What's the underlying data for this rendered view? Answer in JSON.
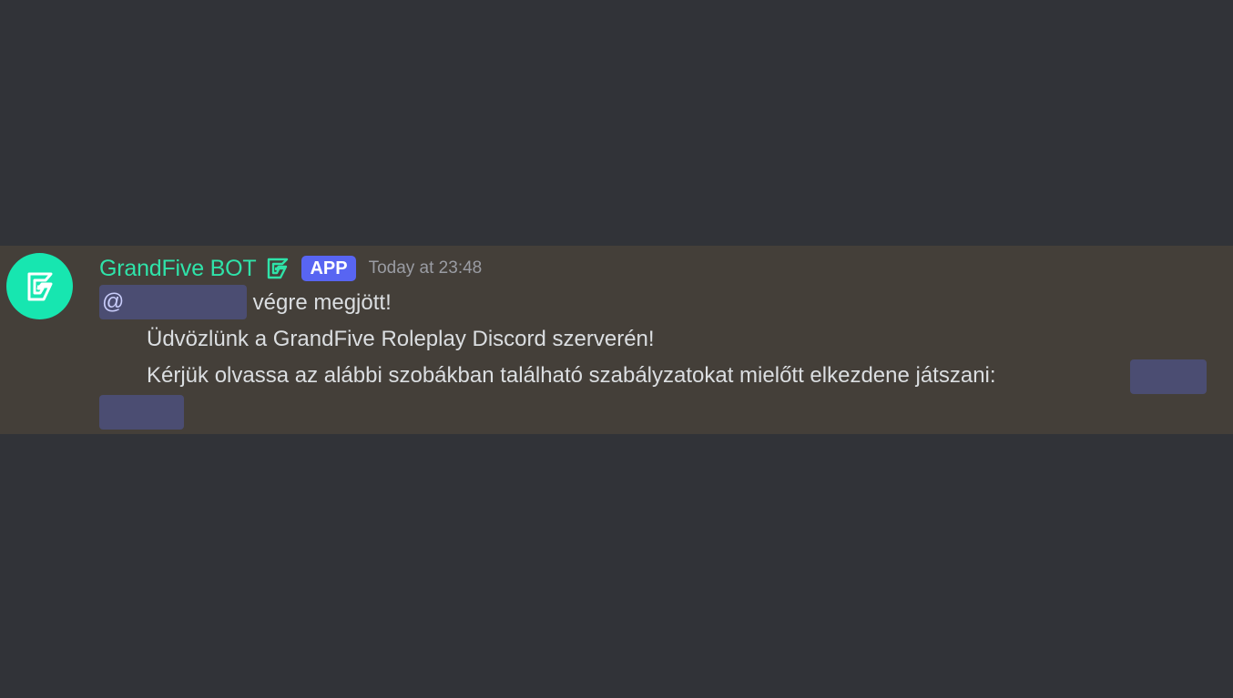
{
  "message": {
    "author": "GrandFive BOT",
    "author_color": "#2fe3a9",
    "avatar_icon": "grandfive-logo",
    "avatar_color": "#17e6b0",
    "role_icon": "grandfive-logo-icon",
    "app_tag": "APP",
    "timestamp": "Today at 23:48",
    "mention_prefix": "@",
    "line1_rest": " végre megjött!",
    "line2": "Üdvözlünk a GrandFive Roleplay Discord szerverén!",
    "line3": "Kérjük olvassa az alábbi szobákban található szabályzatokat mielőtt elkezdene játszani: "
  },
  "colors": {
    "background": "#313338",
    "highlight_background": "#443f39",
    "mention_background": "#4b4d72",
    "app_tag_background": "#5865f2"
  }
}
